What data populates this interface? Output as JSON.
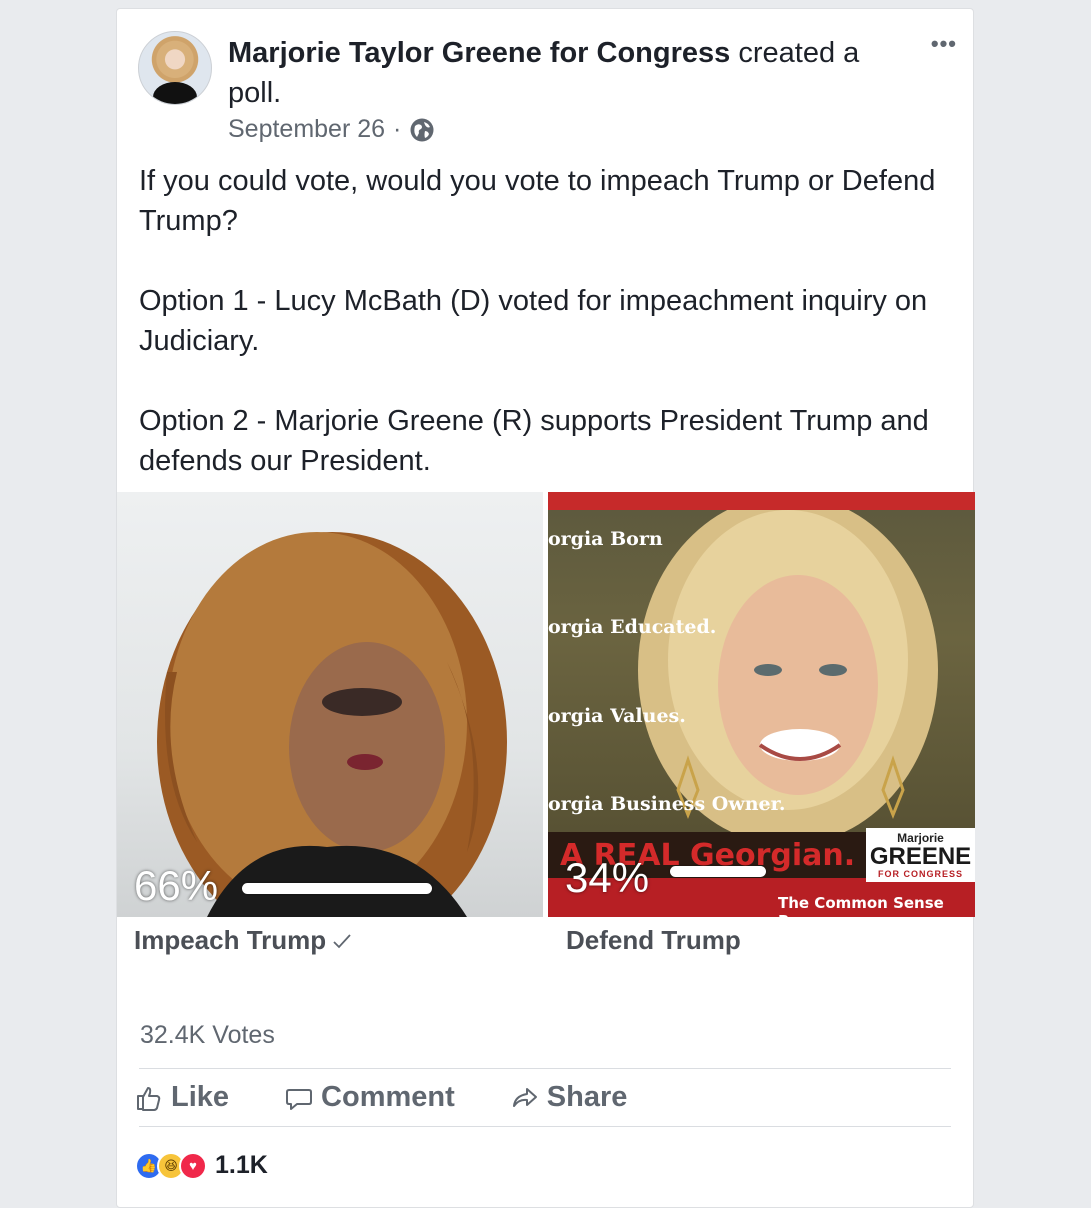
{
  "post": {
    "author": "Marjorie Taylor Greene for Congress",
    "action": "created a poll.",
    "date": "September 26",
    "separator": "·",
    "privacy_icon": "globe-icon",
    "more_icon": "more-options-icon",
    "text": "If you could vote, would you vote to impeach Trump or Defend Trump?\n\nOption 1 - Lucy McBath (D) voted for impeachment inquiry on Judiciary.\n\nOption 2 - Marjorie Greene (R) supports President Trump and defends our President."
  },
  "poll": {
    "options": [
      {
        "label": "Impeach Trump",
        "percent_text": "66%",
        "percent": 66,
        "selected": true
      },
      {
        "label": "Defend Trump",
        "percent_text": "34%",
        "percent": 34,
        "selected": false
      }
    ],
    "image2_text": {
      "line1": "orgia Born",
      "line2": "orgia Educated.",
      "line3": "orgia Values.",
      "line4": "orgia Business Owner.",
      "headline": "A REAL Georgian.",
      "logo_top": "Marjorie",
      "logo_main": "GREENE",
      "logo_sub": "FOR CONGRESS",
      "tagline": "The Common Sense Revo"
    },
    "votes": "32.4K Votes"
  },
  "actions": {
    "like": "Like",
    "comment": "Comment",
    "share": "Share"
  },
  "reactions": {
    "count": "1.1K",
    "icons": [
      "like-reaction-icon",
      "haha-reaction-icon",
      "love-reaction-icon"
    ]
  },
  "colors": {
    "accent_blue": "#2e6bf0",
    "red": "#b71f24"
  }
}
